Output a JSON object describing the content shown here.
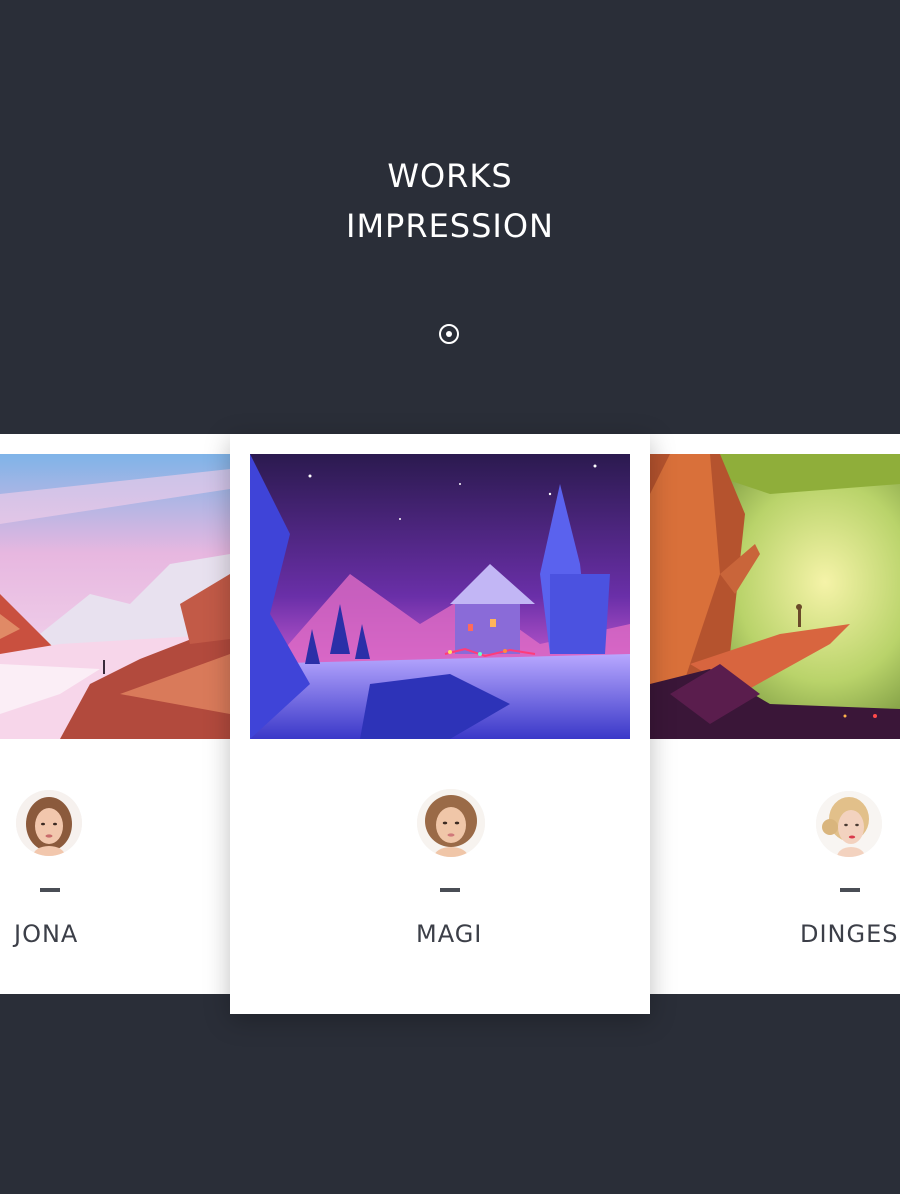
{
  "header": {
    "title_line1": "WORKS",
    "title_line2": "IMPRESSION",
    "indicator_icon": "target-dot-icon"
  },
  "cards": [
    {
      "name": "JONA",
      "artwork": "pink-mountain-landscape",
      "avatar": "woman-portrait-avatar"
    },
    {
      "name": "MAGI",
      "artwork": "snowy-night-cabin",
      "avatar": "woman-portrait-avatar"
    },
    {
      "name": "DINGES",
      "artwork": "forest-sunlight-scene",
      "avatar": "woman-portrait-avatar"
    }
  ],
  "colors": {
    "background": "#2a2e38",
    "card": "#ffffff",
    "text_light": "#ffffff",
    "text_dark": "#3c3f48"
  }
}
